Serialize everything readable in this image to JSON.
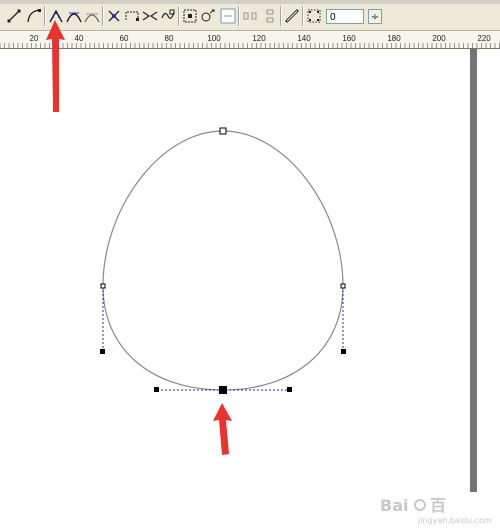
{
  "toolbar": {
    "tools": [
      "line-tool-icon",
      "curve-tool-icon",
      "cusp-node-icon",
      "smooth-node-icon",
      "symmetric-node-icon",
      "reverse-direction-icon",
      "extend-curve-icon",
      "join-nodes-icon",
      "break-curve-icon",
      "extract-subpath-icon",
      "stretch-nodes-icon",
      "rotate-nodes-icon",
      "align-nodes-icon",
      "elastic-mode-icon",
      "select-all-nodes-icon"
    ],
    "curve_smoothness_value": "0",
    "spin_glyph": "÷"
  },
  "ruler": {
    "labels": [
      "20",
      "40",
      "60",
      "80",
      "100",
      "120",
      "140",
      "160",
      "180",
      "200",
      "220"
    ]
  },
  "watermark": {
    "brand": "Bai",
    "brand_suffix": "百",
    "domain": "jingyan.baidu.com"
  },
  "colors": {
    "curve": "#8a8a8a",
    "control_line": "#2a2acc",
    "arrow": "#e8332f",
    "node": "#000000"
  }
}
